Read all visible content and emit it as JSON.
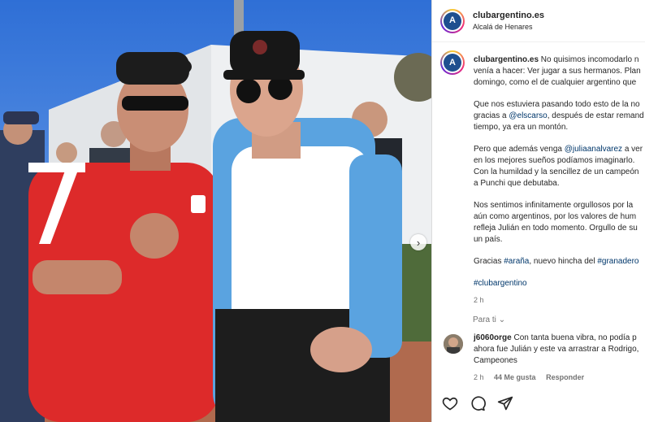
{
  "post": {
    "username": "clubargentino.es",
    "location": "Alcalá de Henares",
    "avatar_letter": "A",
    "next_icon": "chevron-right-icon"
  },
  "caption": {
    "username": "clubargentino.es",
    "lines": [
      "No quisimos incomodarlo n",
      "venía a hacer: Ver jugar a sus hermanos. Plan",
      "domingo, como el de cualquier argentino que"
    ],
    "p2_line1": "Que nos estuviera pasando todo esto de la no",
    "p2_pre": "gracias a ",
    "p2_mention": "@elscarso",
    "p2_post": ", después de estar remand",
    "p2_line3": "tiempo, ya era un montón.",
    "p3_pre": "Pero que además venga ",
    "p3_mention": "@juliaanalvarez",
    "p3_post": " a ver",
    "p3_line2": "en los mejores sueños podíamos imaginarlo.",
    "p3_line3": "Con la humildad y la sencillez de un campeón",
    "p3_line4": "a Punchi que debutaba.",
    "p4_line1": "Nos sentimos infinitamente orgullosos por la",
    "p4_line2": "aún como argentinos, por los valores de hum",
    "p4_line3": "refleja Julián en todo momento. Orgullo de su",
    "p4_line4": "un país.",
    "p5_pre": "Gracias ",
    "p5_tag1": "#araña",
    "p5_mid": ", nuevo hincha del ",
    "p5_tag2": "#granadero",
    "hashtag": "#clubargentino",
    "time": "2 h"
  },
  "para_ti": "Para ti",
  "comment": {
    "username": "j6060orge",
    "line1": " Con tanta buena vibra, no podía p",
    "line2": "ahora fue Julián y este va arrastrar a Rodrigo,",
    "line3": "Campeones",
    "time": "2 h",
    "likes": "44 Me gusta",
    "reply": "Responder"
  },
  "actions": [
    "heart-icon",
    "comment-icon",
    "share-icon"
  ],
  "colors": {
    "link": "#00376b",
    "muted": "#737373",
    "brand": "#1f4f8f"
  }
}
